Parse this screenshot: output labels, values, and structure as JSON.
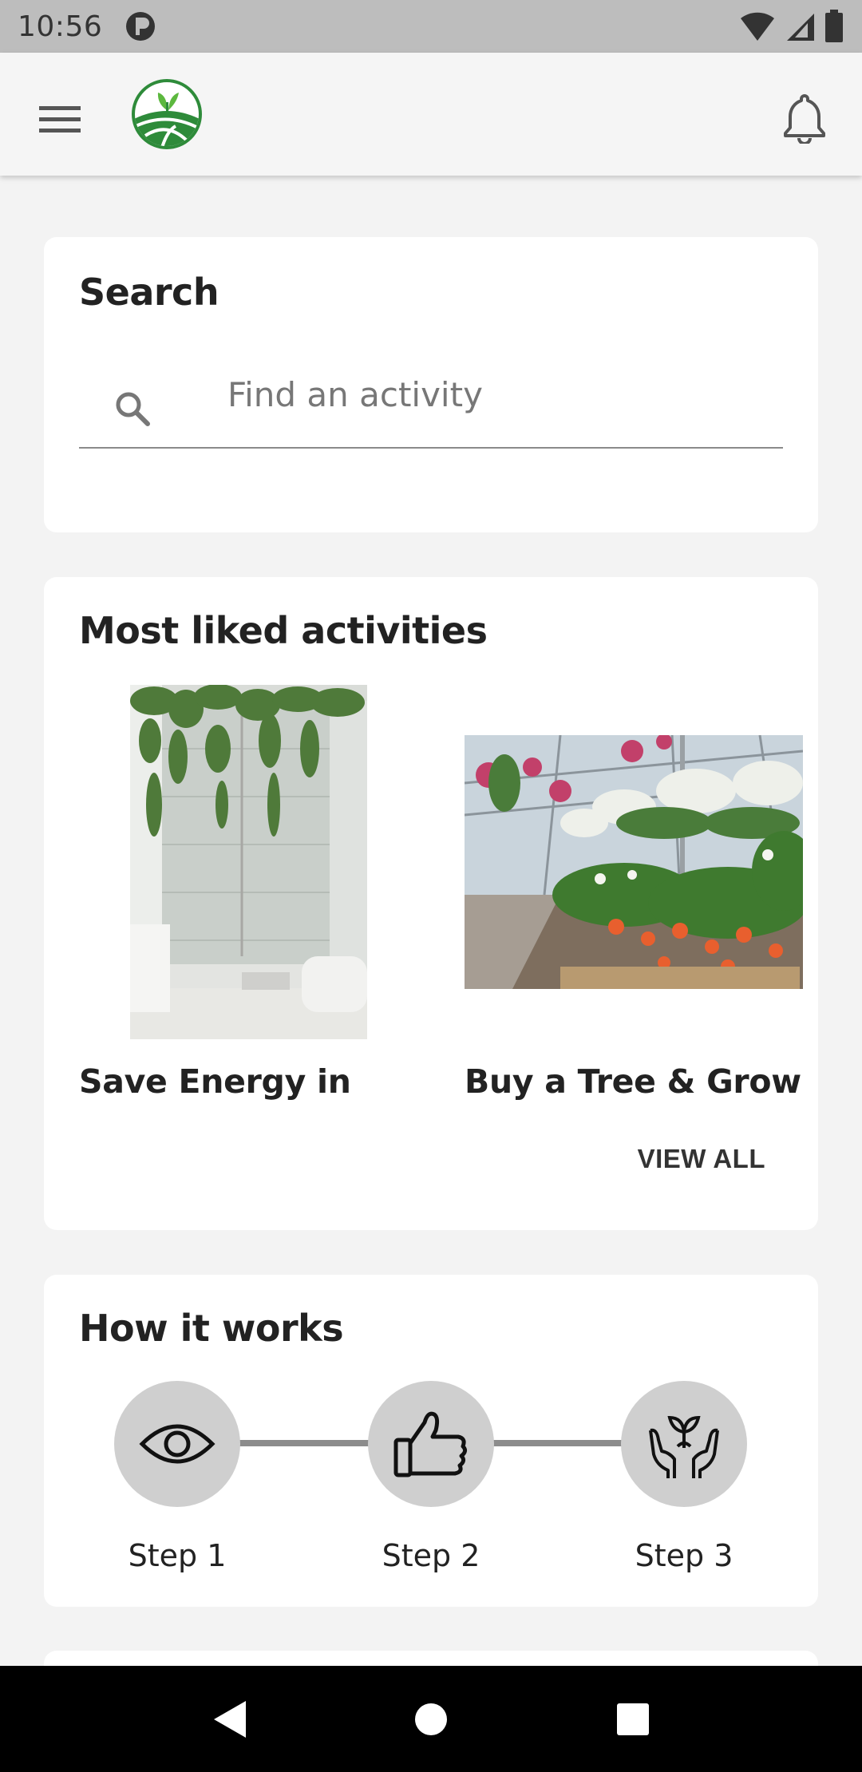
{
  "status_bar": {
    "time": "10:56"
  },
  "app_bar": {
    "menu_icon": "hamburger-menu-icon",
    "logo_icon": "farm-leaf-logo",
    "notification_icon": "bell-icon"
  },
  "search_card": {
    "title": "Search",
    "placeholder": "Find an activity"
  },
  "liked_card": {
    "title": "Most liked activities",
    "activities": [
      {
        "name": "Save Energy in",
        "image": "bathroom-shower-plants-photo"
      },
      {
        "name": "Buy a Tree & Grow",
        "image": "greenhouse-flowers-photo"
      }
    ],
    "view_all_label": "VIEW ALL"
  },
  "how_card": {
    "title": "How it works",
    "steps": [
      {
        "label": "Step 1",
        "icon": "eye-icon"
      },
      {
        "label": "Step 2",
        "icon": "thumbs-up-icon"
      },
      {
        "label": "Step 3",
        "icon": "hands-plant-icon"
      }
    ]
  },
  "colors": {
    "background": "#f3f3f3",
    "brand_green": "#2e8b3a",
    "step_circle": "#cfcfcf"
  }
}
